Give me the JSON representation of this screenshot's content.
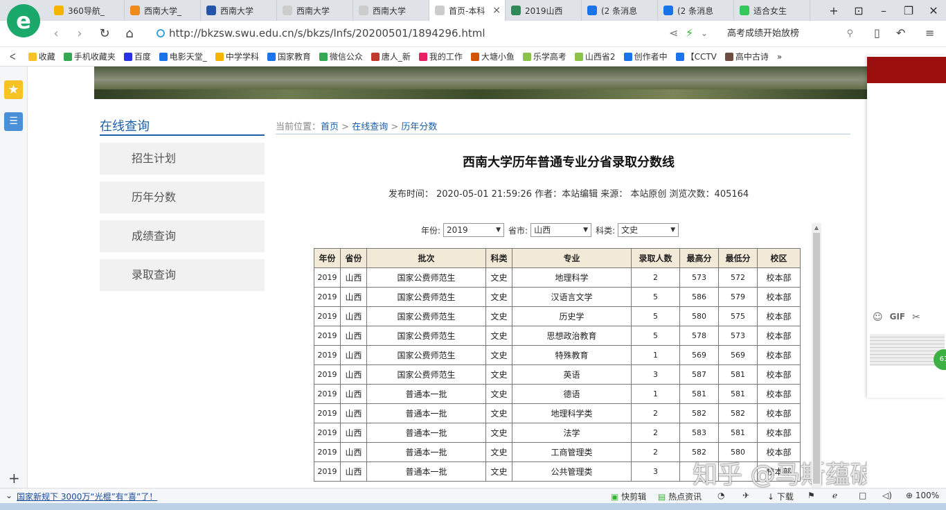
{
  "browser": {
    "tabs": [
      {
        "label": "360导航_",
        "color": "#f4b400"
      },
      {
        "label": "西南大学_",
        "color": "#f08a1c"
      },
      {
        "label": "西南大学",
        "color": "#2255aa"
      },
      {
        "label": "西南大学",
        "color": "#cccccc"
      },
      {
        "label": "西南大学",
        "color": "#cccccc"
      },
      {
        "label": "首页-本科",
        "color": "#cccccc",
        "close": "×"
      },
      {
        "label": "2019山西",
        "color": "#2e8b57"
      },
      {
        "label": "(2 条消息",
        "color": "#1a73e8"
      },
      {
        "label": "(2 条消息",
        "color": "#1a73e8"
      },
      {
        "label": "适合女生",
        "color": "#34c759"
      }
    ],
    "url": "http://bkzsw.swu.edu.cn/s/bkzs/lnfs/20200501/1894296.html",
    "search_text": "高考成绩开始放榜",
    "bookmarks": [
      {
        "label": "收藏",
        "color": "#f7c324"
      },
      {
        "label": "手机收藏夹",
        "color": "#34a853"
      },
      {
        "label": "百度",
        "color": "#2932e1"
      },
      {
        "label": "电影天堂_",
        "color": "#1a73e8"
      },
      {
        "label": "中学学科",
        "color": "#f4b400"
      },
      {
        "label": "国家教育",
        "color": "#1a73e8"
      },
      {
        "label": "微信公众",
        "color": "#34a853"
      },
      {
        "label": "唐人_新",
        "color": "#c0392b"
      },
      {
        "label": "我的工作",
        "color": "#e91e63"
      },
      {
        "label": "大塘小鱼",
        "color": "#d35400"
      },
      {
        "label": "乐学高考",
        "color": "#8bc34a"
      },
      {
        "label": "山西省2",
        "color": "#8bc34a"
      },
      {
        "label": "创作者中",
        "color": "#1a73e8"
      },
      {
        "label": "【CCTV",
        "color": "#1a73e8"
      },
      {
        "label": "高中古诗",
        "color": "#6d4c41"
      }
    ],
    "more": "»"
  },
  "sidebar": {
    "title": "在线查询",
    "items": [
      "招生计划",
      "历年分数",
      "成绩查询",
      "录取查询"
    ]
  },
  "breadcrumb": {
    "prefix": "当前位置：",
    "home": "首页",
    "sep1": " > ",
    "section": "在线查询",
    "sep2": " > ",
    "current": "历年分数"
  },
  "article": {
    "title": "西南大学历年普通专业分省录取分数线",
    "meta": "发布时间： 2020-05-01 21:59:26   作者：本站编辑   来源： 本站原创   浏览次数：405164"
  },
  "filters": {
    "year_label": "年份:",
    "year_value": "2019",
    "province_label": "省市:",
    "province_value": "山西",
    "category_label": "科类:",
    "category_value": "文史"
  },
  "table": {
    "headers": [
      "年份",
      "省份",
      "批次",
      "科类",
      "专业",
      "录取人数",
      "最高分",
      "最低分",
      "校区"
    ],
    "rows": [
      [
        "2019",
        "山西",
        "国家公费师范生",
        "文史",
        "地理科学",
        "2",
        "573",
        "572",
        "校本部"
      ],
      [
        "2019",
        "山西",
        "国家公费师范生",
        "文史",
        "汉语言文学",
        "5",
        "586",
        "579",
        "校本部"
      ],
      [
        "2019",
        "山西",
        "国家公费师范生",
        "文史",
        "历史学",
        "5",
        "580",
        "575",
        "校本部"
      ],
      [
        "2019",
        "山西",
        "国家公费师范生",
        "文史",
        "思想政治教育",
        "5",
        "578",
        "573",
        "校本部"
      ],
      [
        "2019",
        "山西",
        "国家公费师范生",
        "文史",
        "特殊教育",
        "1",
        "569",
        "569",
        "校本部"
      ],
      [
        "2019",
        "山西",
        "国家公费师范生",
        "文史",
        "英语",
        "3",
        "587",
        "581",
        "校本部"
      ],
      [
        "2019",
        "山西",
        "普通本一批",
        "文史",
        "德语",
        "1",
        "581",
        "581",
        "校本部"
      ],
      [
        "2019",
        "山西",
        "普通本一批",
        "文史",
        "地理科学类",
        "2",
        "582",
        "582",
        "校本部"
      ],
      [
        "2019",
        "山西",
        "普通本一批",
        "文史",
        "法学",
        "2",
        "583",
        "581",
        "校本部"
      ],
      [
        "2019",
        "山西",
        "普通本一批",
        "文史",
        "工商管理类",
        "2",
        "582",
        "580",
        "校本部"
      ],
      [
        "2019",
        "山西",
        "普通本一批",
        "文史",
        "公共管理类",
        "3",
        "",
        "",
        "校本部"
      ]
    ]
  },
  "watermark": "知乎 @马斯蕴破头",
  "statusbar": {
    "news": "国家新规下 3000万“光棍”有“喜”了！",
    "kuaijianji": "快剪辑",
    "hot": "热点资讯",
    "download": "下载",
    "zoom": "100%"
  },
  "right_panel": {
    "gif": "GIF",
    "badge": "61"
  }
}
